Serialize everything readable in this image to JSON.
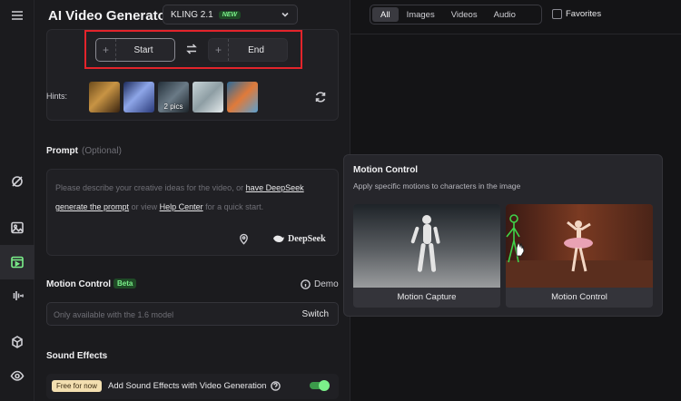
{
  "rail": {
    "icons": [
      "menu-icon",
      "magic-icon",
      "image-icon",
      "video-icon",
      "audio-icon",
      "model-icon",
      "eye-icon"
    ]
  },
  "header": {
    "title": "AI Video Generator",
    "model": "KLING 2.1",
    "model_badge": "NEW"
  },
  "frames": {
    "start_label": "Start",
    "end_label": "End"
  },
  "hints": {
    "label": "Hints:",
    "multi_pics_label": "2 pics"
  },
  "prompt": {
    "title": "Prompt",
    "optional": "(Optional)",
    "placeholder_start": "Please describe your creative ideas for the video, or ",
    "link_deepseek": "have DeepSeek generate the prompt",
    "mid": " or view ",
    "link_help": "Help Center",
    "end": " for a quick start.",
    "deepseek_label": "DeepSeek"
  },
  "motion_control": {
    "title": "Motion Control",
    "badge": "Beta",
    "demo": "Demo",
    "placeholder": "Only available with the 1.6 model",
    "switch": "Switch"
  },
  "sound_effects": {
    "title": "Sound Effects",
    "free_badge": "Free for now",
    "label": "Add Sound Effects with Video Generation",
    "enabled": true
  },
  "filters": {
    "tabs": [
      "All",
      "Images",
      "Videos",
      "Audio"
    ],
    "active": "All",
    "favorites": "Favorites"
  },
  "popover": {
    "title": "Motion Control",
    "description": "Apply specific motions to characters in the image",
    "cards": [
      "Motion Capture",
      "Motion Control"
    ]
  }
}
